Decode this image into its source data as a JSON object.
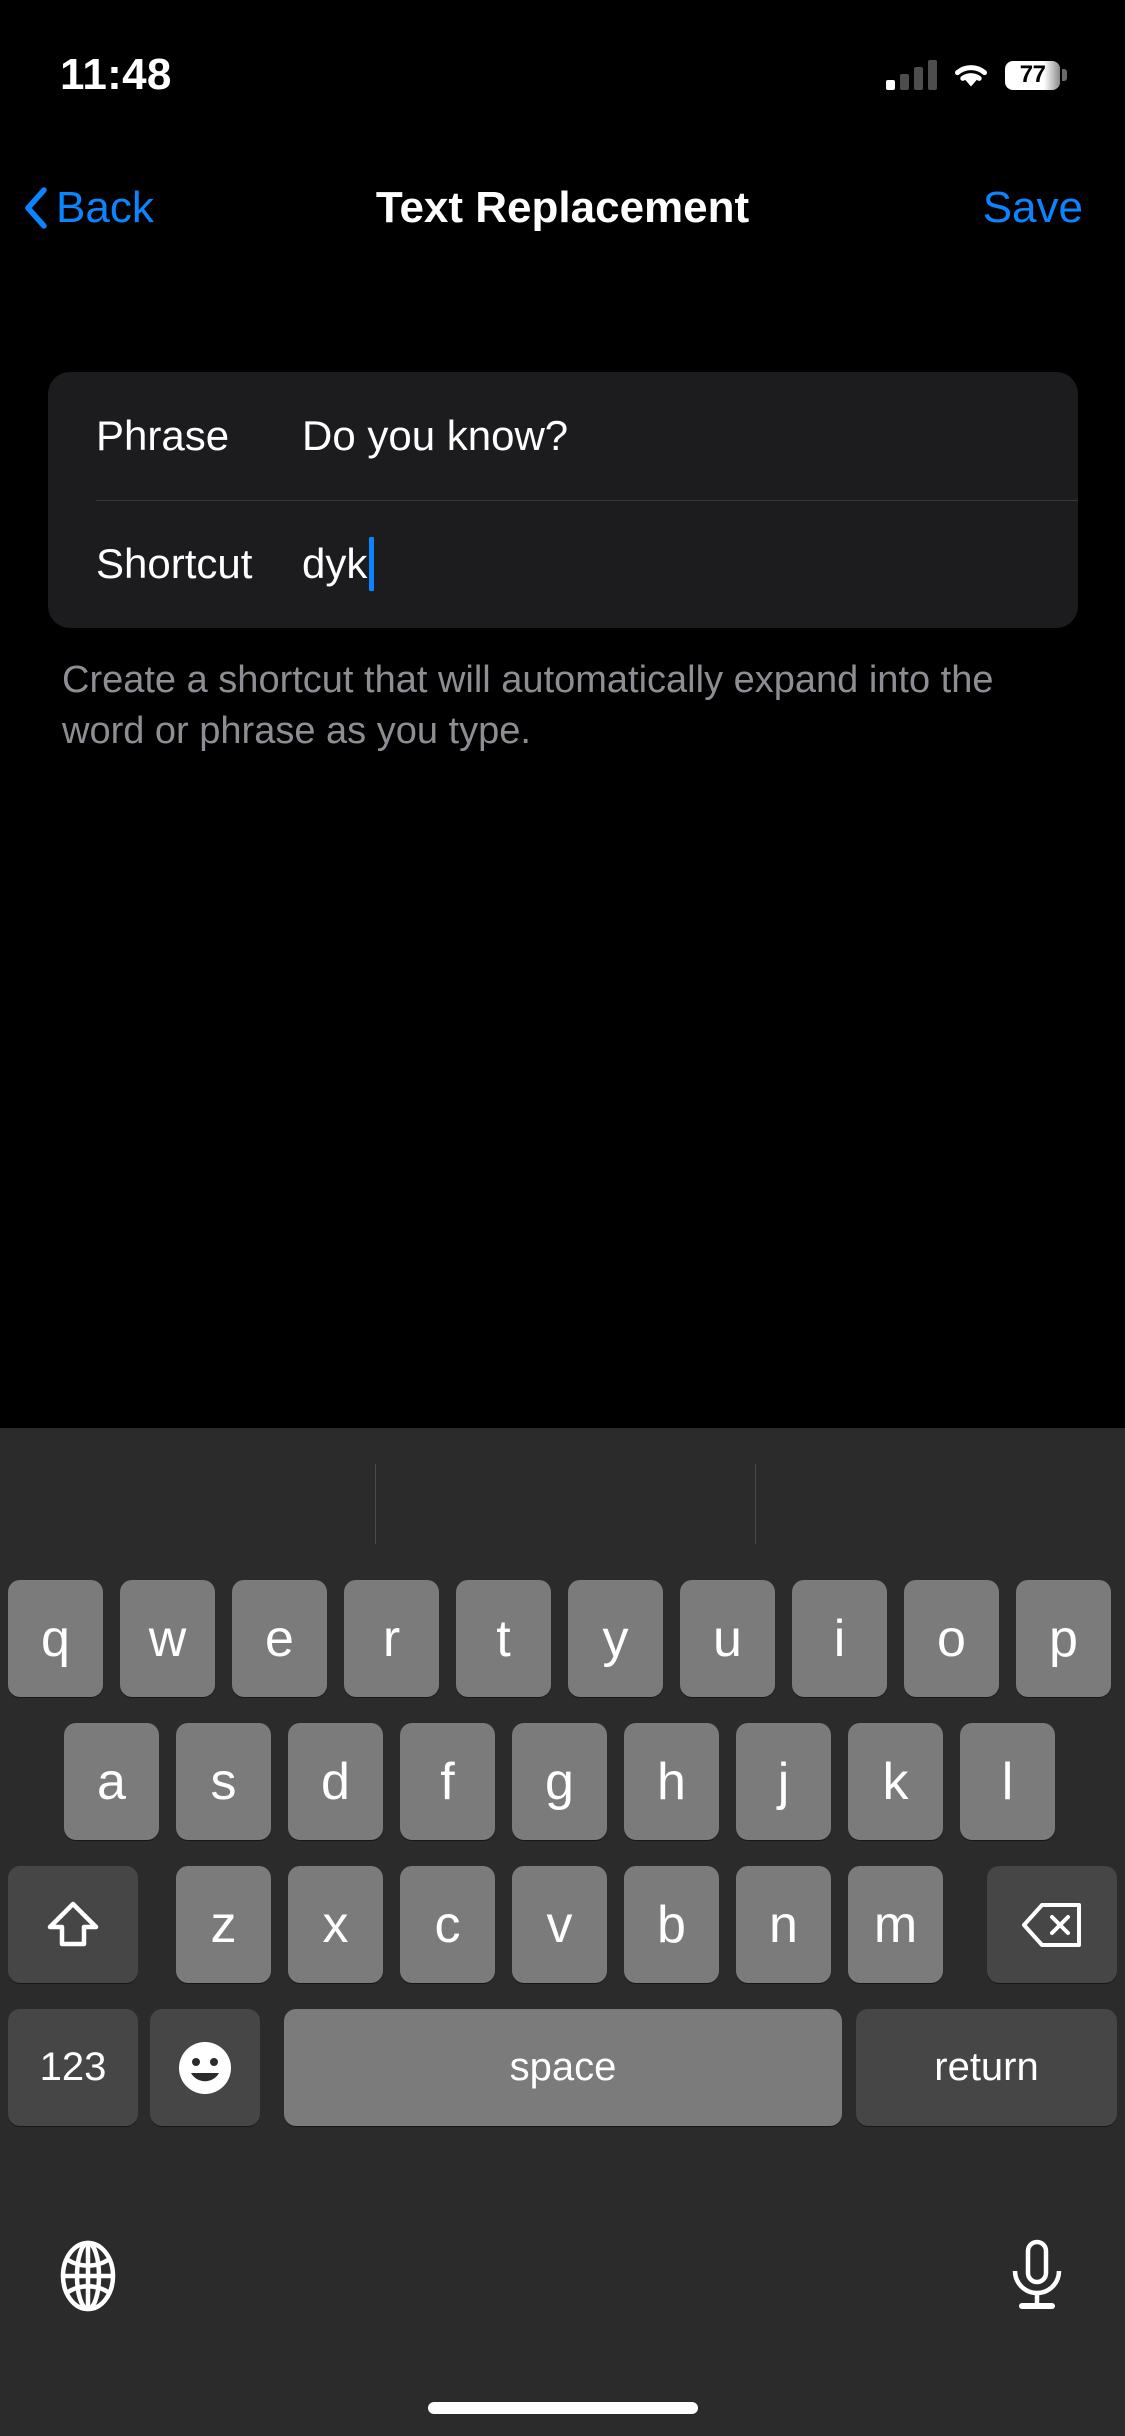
{
  "status_bar": {
    "time": "11:48",
    "battery_percent": "77",
    "wifi_icon": "wifi-icon",
    "cellular_icon": "cellular-signal-icon",
    "battery_icon": "battery-icon"
  },
  "nav_bar": {
    "back_label": "Back",
    "back_icon": "chevron-left-icon",
    "title": "Text Replacement",
    "save_label": "Save",
    "accent_color": "#0a84ff"
  },
  "form": {
    "rows": [
      {
        "label": "Phrase",
        "value": "Do you know?"
      },
      {
        "label": "Shortcut",
        "value": "dyk"
      }
    ],
    "caret_color": "#0a84ff",
    "caret_after_row": 1
  },
  "footnote": "Create a shortcut that will automatically expand into the word or phrase as you type.",
  "keyboard": {
    "predictive_bar": {
      "suggestions": [
        "",
        "",
        ""
      ]
    },
    "rows": [
      [
        "q",
        "w",
        "e",
        "r",
        "t",
        "y",
        "u",
        "i",
        "o",
        "p"
      ],
      [
        "a",
        "s",
        "d",
        "f",
        "g",
        "h",
        "j",
        "k",
        "l"
      ],
      [
        "z",
        "x",
        "c",
        "v",
        "b",
        "n",
        "m"
      ]
    ],
    "shift_key": {
      "name": "shift-key",
      "icon": "shift-arrow-icon"
    },
    "backspace_key": {
      "name": "backspace-key",
      "icon": "delete-left-icon"
    },
    "numbers_key_label": "123",
    "emoji_key": {
      "name": "emoji-key",
      "icon": "smiley-face-icon"
    },
    "space_key_label": "space",
    "return_key_label": "return",
    "globe_key": {
      "name": "globe-key",
      "icon": "globe-icon"
    },
    "dictation_key": {
      "name": "dictation-key",
      "icon": "microphone-icon"
    },
    "home_indicator": "home-indicator"
  }
}
